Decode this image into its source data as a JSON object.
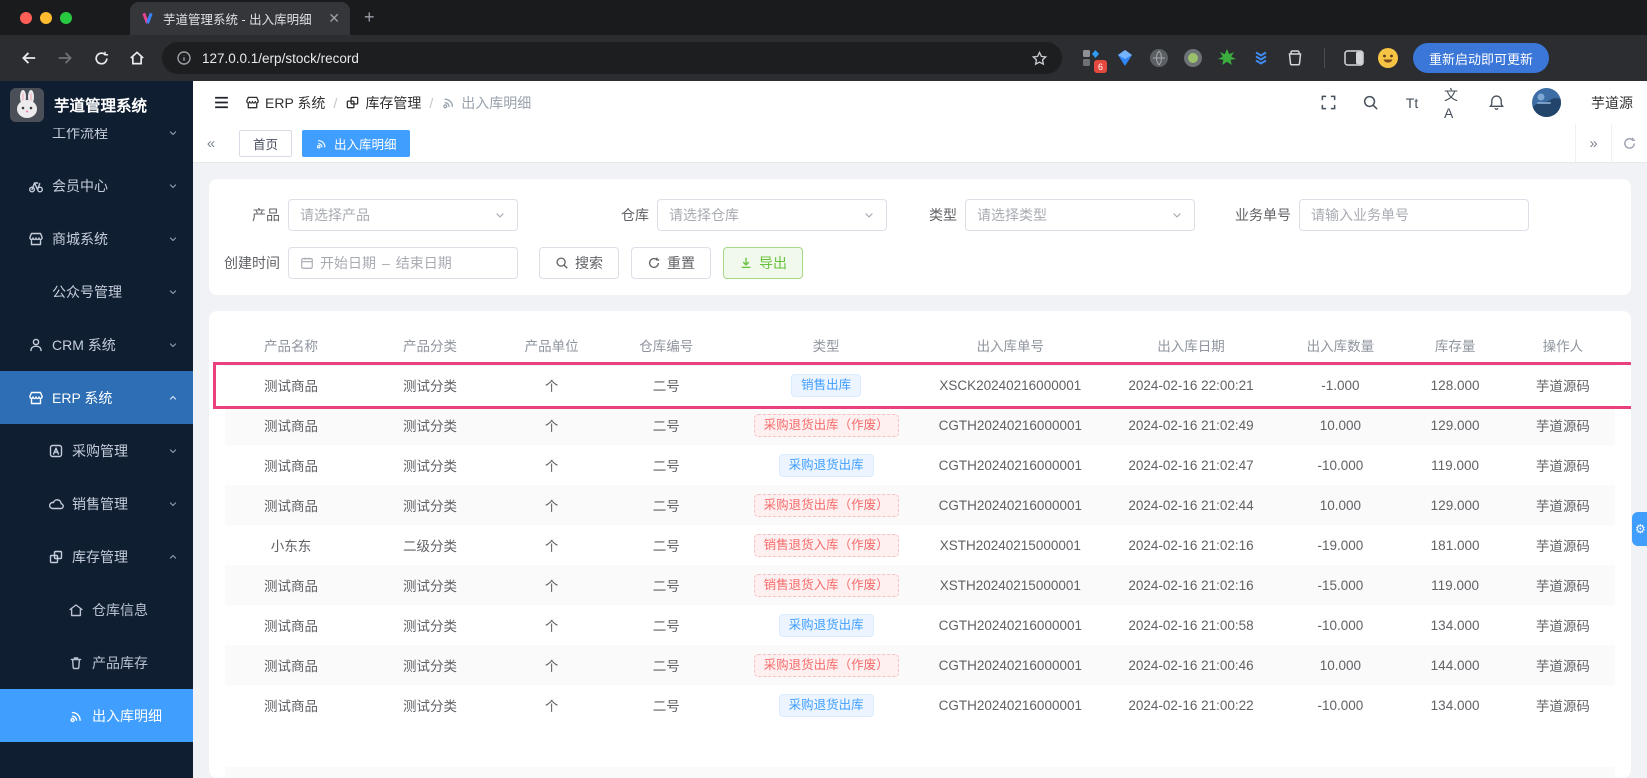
{
  "browser": {
    "tab_title": "芋道管理系统 - 出入库明细",
    "url": "127.0.0.1/erp/stock/record",
    "extension_badge": "6",
    "update_button_label": "重新启动即可更新"
  },
  "logo": {
    "title": "芋道管理系统"
  },
  "sidebar": {
    "items": [
      {
        "label": "工作流程",
        "icon": null,
        "chevron": "down",
        "level": 1,
        "active": null
      },
      {
        "label": "会员中心",
        "icon": "member-icon",
        "chevron": "down",
        "level": 0,
        "active": null
      },
      {
        "label": "商城系统",
        "icon": "mall-icon",
        "chevron": "down",
        "level": 0,
        "active": null
      },
      {
        "label": "公众号管理",
        "icon": null,
        "chevron": "down",
        "level": 1,
        "active": null
      },
      {
        "label": "CRM 系统",
        "icon": "crm-icon",
        "chevron": "down",
        "level": 0,
        "active": null
      },
      {
        "label": "ERP 系统",
        "icon": "erp-icon",
        "chevron": "up",
        "level": 0,
        "active": "parent"
      },
      {
        "label": "采购管理",
        "icon": "purchase-icon",
        "chevron": "down",
        "level": 1,
        "active": null
      },
      {
        "label": "销售管理",
        "icon": "sales-icon",
        "chevron": "down",
        "level": 1,
        "active": null
      },
      {
        "label": "库存管理",
        "icon": "stock-icon",
        "chevron": "up",
        "level": 1,
        "active": null
      },
      {
        "label": "仓库信息",
        "icon": "warehouse-icon",
        "chevron": null,
        "level": 2,
        "active": null
      },
      {
        "label": "产品库存",
        "icon": "product-stock-icon",
        "chevron": null,
        "level": 2,
        "active": null
      },
      {
        "label": "出入库明细",
        "icon": "record-icon",
        "chevron": null,
        "level": 2,
        "active": "item"
      }
    ]
  },
  "header": {
    "breadcrumb": [
      {
        "label": "ERP 系统",
        "icon": "erp-icon"
      },
      {
        "label": "库存管理",
        "icon": "stock-icon"
      },
      {
        "label": "出入库明细",
        "icon": "record-icon"
      }
    ],
    "font_tool_label": "Tt",
    "translate_tool_label": "文A",
    "username": "芋道源"
  },
  "pagetabs": {
    "items": [
      {
        "label": "首页",
        "icon": null,
        "active": false
      },
      {
        "label": "出入库明细",
        "icon": "record-icon",
        "active": true
      }
    ]
  },
  "filters": {
    "product_label": "产品",
    "product_placeholder": "请选择产品",
    "warehouse_label": "仓库",
    "warehouse_placeholder": "请选择仓库",
    "type_label": "类型",
    "type_placeholder": "请选择类型",
    "bizno_label": "业务单号",
    "bizno_placeholder": "请输入业务单号",
    "date_label": "创建时间",
    "date_start_placeholder": "开始日期",
    "date_separator": "–",
    "date_end_placeholder": "结束日期",
    "search_label": "搜索",
    "reset_label": "重置",
    "export_label": "导出"
  },
  "table": {
    "headers": [
      "产品名称",
      "产品分类",
      "产品单位",
      "仓库编号",
      "类型",
      "出入库单号",
      "出入库日期",
      "出入库数量",
      "库存量",
      "操作人"
    ],
    "rows": [
      {
        "product": "测试商品",
        "category": "测试分类",
        "unit": "个",
        "warehouse": "二号",
        "type": "销售出库",
        "type_color": "blue",
        "order_no": "XSCK20240216000001",
        "date": "2024-02-16 22:00:21",
        "quantity": "-1.000",
        "stock": "128.000",
        "operator": "芋道源码",
        "annotated": true
      },
      {
        "product": "测试商品",
        "category": "测试分类",
        "unit": "个",
        "warehouse": "二号",
        "type": "采购退货出库（作废）",
        "type_color": "red",
        "order_no": "CGTH20240216000001",
        "date": "2024-02-16 21:02:49",
        "quantity": "10.000",
        "stock": "129.000",
        "operator": "芋道源码",
        "annotated": false
      },
      {
        "product": "测试商品",
        "category": "测试分类",
        "unit": "个",
        "warehouse": "二号",
        "type": "采购退货出库",
        "type_color": "blue",
        "order_no": "CGTH20240216000001",
        "date": "2024-02-16 21:02:47",
        "quantity": "-10.000",
        "stock": "119.000",
        "operator": "芋道源码",
        "annotated": false
      },
      {
        "product": "测试商品",
        "category": "测试分类",
        "unit": "个",
        "warehouse": "二号",
        "type": "采购退货出库（作废）",
        "type_color": "red",
        "order_no": "CGTH20240216000001",
        "date": "2024-02-16 21:02:44",
        "quantity": "10.000",
        "stock": "129.000",
        "operator": "芋道源码",
        "annotated": false
      },
      {
        "product": "小东东",
        "category": "二级分类",
        "unit": "个",
        "warehouse": "二号",
        "type": "销售退货入库（作废）",
        "type_color": "red",
        "order_no": "XSTH20240215000001",
        "date": "2024-02-16 21:02:16",
        "quantity": "-19.000",
        "stock": "181.000",
        "operator": "芋道源码",
        "annotated": false
      },
      {
        "product": "测试商品",
        "category": "测试分类",
        "unit": "个",
        "warehouse": "二号",
        "type": "销售退货入库（作废）",
        "type_color": "red",
        "order_no": "XSTH20240215000001",
        "date": "2024-02-16 21:02:16",
        "quantity": "-15.000",
        "stock": "119.000",
        "operator": "芋道源码",
        "annotated": false
      },
      {
        "product": "测试商品",
        "category": "测试分类",
        "unit": "个",
        "warehouse": "二号",
        "type": "采购退货出库",
        "type_color": "blue",
        "order_no": "CGTH20240216000001",
        "date": "2024-02-16 21:00:58",
        "quantity": "-10.000",
        "stock": "134.000",
        "operator": "芋道源码",
        "annotated": false
      },
      {
        "product": "测试商品",
        "category": "测试分类",
        "unit": "个",
        "warehouse": "二号",
        "type": "采购退货出库（作废）",
        "type_color": "red",
        "order_no": "CGTH20240216000001",
        "date": "2024-02-16 21:00:46",
        "quantity": "10.000",
        "stock": "144.000",
        "operator": "芋道源码",
        "annotated": false
      },
      {
        "product": "测试商品",
        "category": "测试分类",
        "unit": "个",
        "warehouse": "二号",
        "type": "采购退货出库",
        "type_color": "blue",
        "order_no": "CGTH20240216000001",
        "date": "2024-02-16 21:00:22",
        "quantity": "-10.000",
        "stock": "134.000",
        "operator": "芋道源码",
        "annotated": false
      }
    ]
  },
  "colors": {
    "primary": "#409eff",
    "annotation_box": "#e8417d",
    "success_text": "#67c23a",
    "danger_text": "#f56c6c",
    "sidebar_bg": "#101e32"
  }
}
